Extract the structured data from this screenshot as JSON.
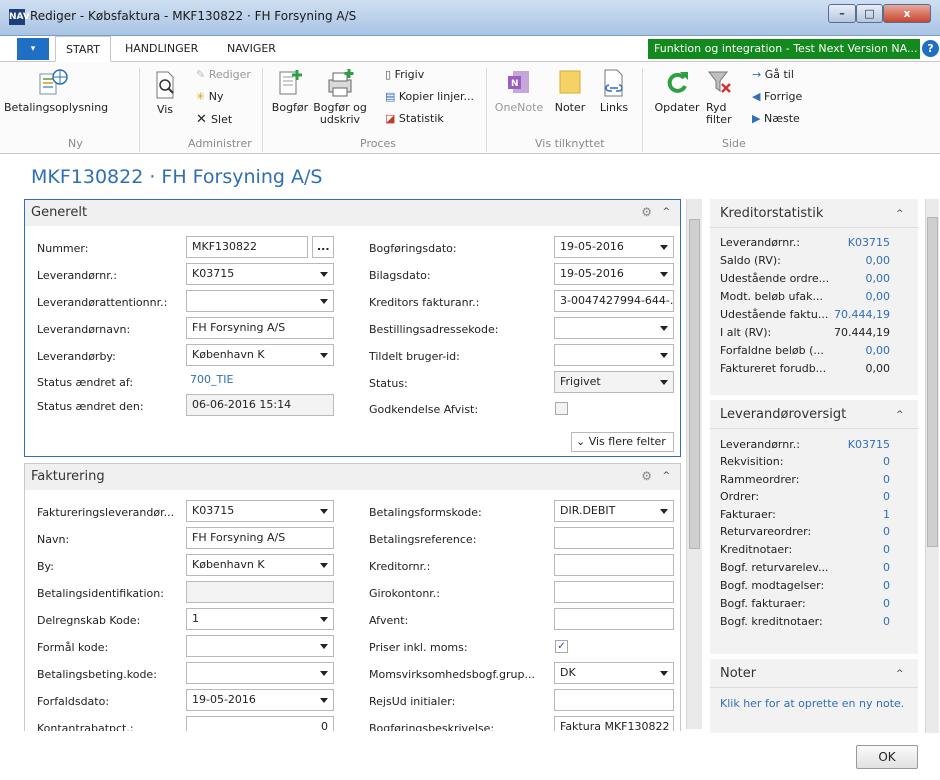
{
  "window": {
    "title": "Rediger - Købsfaktura - MKF130822 · FH Forsyning A/S",
    "logo": "NAV",
    "min": "–",
    "max": "□",
    "close": "x"
  },
  "tabs": {
    "file": "▾",
    "items": [
      "START",
      "HANDLINGER",
      "NAVIGER"
    ],
    "green": "Funktion og integration - Test Next Version NA...",
    "help": "?"
  },
  "ribbon": {
    "ny": {
      "betalingsoplysning": "Betalingsoplysning",
      "group": "Ny"
    },
    "admin": {
      "vis": "Vis",
      "rediger": "Rediger",
      "ny": "Ny",
      "slet": "Slet",
      "group": "Administrer"
    },
    "proces": {
      "bogfor": "Bogfør",
      "bogfor_udskriv": "Bogfør og udskriv",
      "frigiv": "Frigiv",
      "kopier": "Kopier linjer...",
      "statistik": "Statistik",
      "group": "Proces"
    },
    "tilknyttet": {
      "onenote": "OneNote",
      "noter": "Noter",
      "links": "Links",
      "group": "Vis tilknyttet"
    },
    "side": {
      "opdater": "Opdater",
      "ryd_filter": "Ryd filter",
      "ga_til": "Gå til",
      "forrige": "Forrige",
      "naeste": "Næste",
      "group": "Side"
    }
  },
  "page_title": "MKF130822 · FH Forsyning A/S",
  "generelt": {
    "title": "Generelt",
    "nummer_label": "Nummer:",
    "nummer": "MKF130822",
    "ellipsis": "...",
    "levnr_label": "Leverandørnr.:",
    "levnr": "K03715",
    "levatt_label": "Leverandørattentionnr.:",
    "levatt": "",
    "levnavn_label": "Leverandørnavn:",
    "levnavn": "FH Forsyning A/S",
    "levby_label": "Leverandørby:",
    "levby": "København K",
    "status_af_label": "Status ændret af:",
    "status_af": "700_TIE",
    "status_den_label": "Status ændret den:",
    "status_den": "06-06-2016 15:14",
    "bogfdato_label": "Bogføringsdato:",
    "bogfdato": "19-05-2016",
    "bilagsdato_label": "Bilagsdato:",
    "bilagsdato": "19-05-2016",
    "kredfak_label": "Kreditors fakturanr.:",
    "kredfak": "3-0047427994-644-...",
    "bestadr_label": "Bestillingsadressekode:",
    "bestadr": "",
    "tildelt_label": "Tildelt bruger-id:",
    "tildelt": "",
    "status_label": "Status:",
    "status": "Frigivet",
    "godk_label": "Godkendelse Afvist:",
    "vis_flere": "Vis flere felter"
  },
  "fakturering": {
    "title": "Fakturering",
    "faklev_label": "Faktureringsleverandør...",
    "faklev": "K03715",
    "navn_label": "Navn:",
    "navn": "FH Forsyning A/S",
    "by_label": "By:",
    "by": "København K",
    "betid_label": "Betalingsidentifikation:",
    "betid": "",
    "delregn_label": "Delregnskab Kode:",
    "delregn": "1",
    "formaal_label": "Formål kode:",
    "formaal": "",
    "betbeting_label": "Betalingsbeting.kode:",
    "betbeting": "",
    "forfald_label": "Forfaldsdato:",
    "forfald": "19-05-2016",
    "kontant_label": "Kontantrabatpct.:",
    "kontant": "0",
    "betform_label": "Betalingsformskode:",
    "betform": "DIR.DEBIT",
    "betref_label": "Betalingsreference:",
    "betref": "",
    "kreditornr_label": "Kreditornr.:",
    "kreditornr": "",
    "giro_label": "Girokontonr.:",
    "giro": "",
    "afvent_label": "Afvent:",
    "afvent": "",
    "priser_label": "Priser inkl. moms:",
    "priser_check": "✓",
    "moms_label": "Momsvirksomhedsbogf.grup...",
    "moms": "DK",
    "rejsud_label": "RejsUd initialer:",
    "rejsud": "",
    "bogfbeskr_label": "Bogføringsbeskrivelse:",
    "bogfbeskr": "Faktura MKF130822"
  },
  "kreditorstatistik": {
    "title": "Kreditorstatistik",
    "rows": [
      {
        "label": "Leverandørnr.:",
        "value": "K03715"
      },
      {
        "label": "Saldo (RV):",
        "value": "0,00"
      },
      {
        "label": "Udestående ordre...",
        "value": "0,00"
      },
      {
        "label": "Modt. beløb ufak...",
        "value": "0,00"
      },
      {
        "label": "Udestående faktu...",
        "value": "70.444,19"
      },
      {
        "label": "I alt (RV):",
        "value": "70.444,19"
      },
      {
        "label": "Forfaldne beløb (...",
        "value": "0,00"
      },
      {
        "label": "Faktureret forudb...",
        "value": "0,00"
      }
    ]
  },
  "leverandoroversigt": {
    "title": "Leverandøroversigt",
    "rows": [
      {
        "label": "Leverandørnr.:",
        "value": "K03715"
      },
      {
        "label": "Rekvisition:",
        "value": "0"
      },
      {
        "label": "Rammeordrer:",
        "value": "0"
      },
      {
        "label": "Ordrer:",
        "value": "0"
      },
      {
        "label": "Fakturaer:",
        "value": "1"
      },
      {
        "label": "Returvareordrer:",
        "value": "0"
      },
      {
        "label": "Kreditnotaer:",
        "value": "0"
      },
      {
        "label": "Bogf. returvarelev...",
        "value": "0"
      },
      {
        "label": "Bogf. modtagelser:",
        "value": "0"
      },
      {
        "label": "Bogf. fakturaer:",
        "value": "0"
      },
      {
        "label": "Bogf. kreditnotaer:",
        "value": "0"
      }
    ]
  },
  "noter": {
    "title": "Noter",
    "link": "Klik her for at oprette en ny note."
  },
  "ok": "OK"
}
